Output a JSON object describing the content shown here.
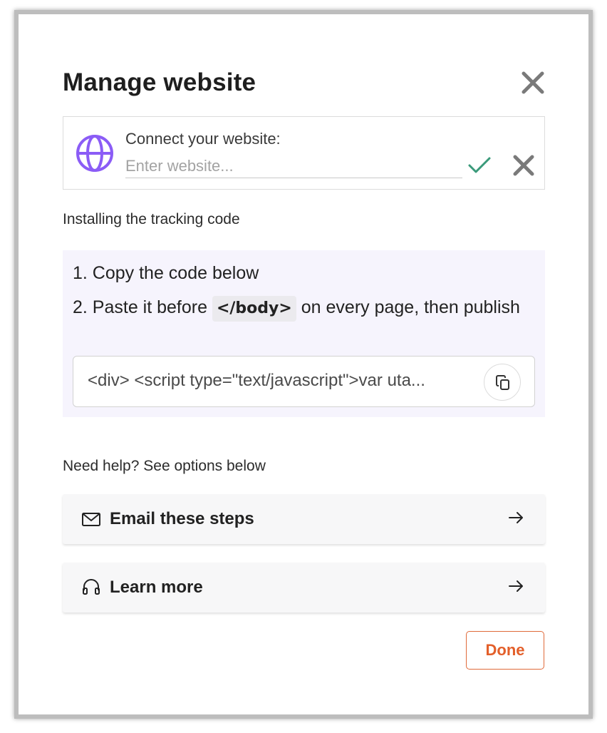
{
  "modal": {
    "title": "Manage website"
  },
  "connect": {
    "label": "Connect your website:",
    "placeholder": "Enter website...",
    "value": ""
  },
  "install": {
    "heading": "Installing the tracking code",
    "step1": "1. Copy the code below",
    "step2_before": "2. Paste it before ",
    "step2_tag": "</body>",
    "step2_after": " on every page, then publish",
    "code_snippet": "<div> <script type=\"text/javascript\">var uta..."
  },
  "help": {
    "heading": "Need help? See options below",
    "options": [
      {
        "label": "Email these steps",
        "icon": "mail-icon"
      },
      {
        "label": "Learn more",
        "icon": "headset-icon"
      }
    ]
  },
  "footer": {
    "done_label": "Done"
  },
  "colors": {
    "accent": "#8b5cf6",
    "confirm": "#3a9a7a",
    "done": "#e35f2a",
    "panel_bg": "#f6f4fd"
  }
}
